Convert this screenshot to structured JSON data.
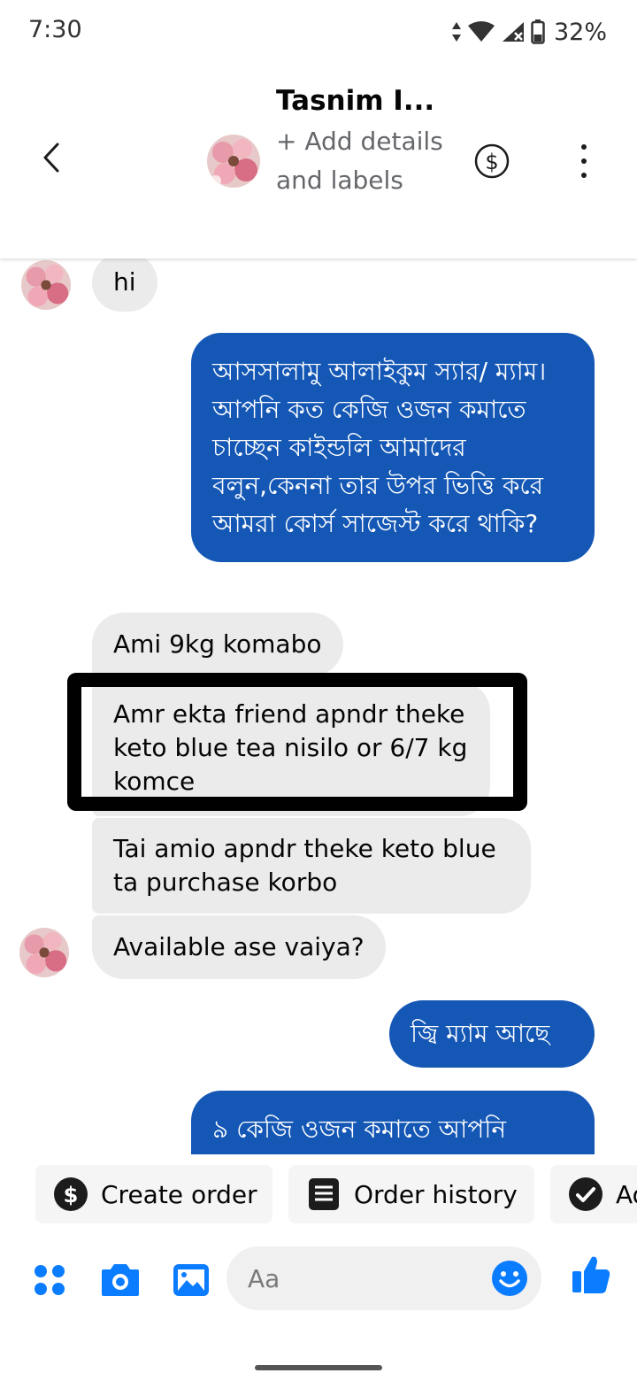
{
  "status_bar": {
    "time": "7:30",
    "battery": "32%"
  },
  "header": {
    "contact_name": "Tasnim I...",
    "subtitle": "+ Add details and labels",
    "back_icon": "chevron-left-icon",
    "payment_icon": "dollar-circle-icon",
    "more_icon": "more-vertical-icon"
  },
  "messages": [
    {
      "from": "contact",
      "text": "hi"
    },
    {
      "from": "me",
      "text": "আসসালামু আলাইকুম স্যার/ ম্যাম। আপনি কত কেজি ওজন কমাতে চাচ্ছেন কাইন্ডলি আমাদের বলুন,কেননা তার উপর ভিত্তি করে আমরা কোর্স সাজেস্ট করে থাকি?"
    },
    {
      "from": "contact",
      "text": "Ami 9kg komabo"
    },
    {
      "from": "contact",
      "text": "Amr ekta friend apndr theke keto blue tea nisilo or 6/7 kg komce"
    },
    {
      "from": "contact",
      "text": "Tai amio apndr theke keto blue ta purchase korbo"
    },
    {
      "from": "contact",
      "text": "Available ase vaiya?"
    },
    {
      "from": "me",
      "text": "জ্বি ম্যাম আছে"
    },
    {
      "from": "me",
      "text": "৯ কেজি ওজন কমাতে আপনি"
    }
  ],
  "quick_actions": [
    {
      "label": "Create order",
      "icon": "dollar-circle-icon"
    },
    {
      "label": "Order history",
      "icon": "receipt-list-icon"
    },
    {
      "label": "Ad",
      "icon": "check-circle-icon"
    }
  ],
  "composer": {
    "placeholder": "Aa",
    "icons": [
      "apps-grid-icon",
      "camera-icon",
      "gallery-icon",
      "emoji-icon",
      "thumbs-up-icon"
    ]
  },
  "colors": {
    "accent": "#0a7cff",
    "outgoing_bubble": "#1457b5",
    "incoming_bubble": "#ebebeb"
  }
}
